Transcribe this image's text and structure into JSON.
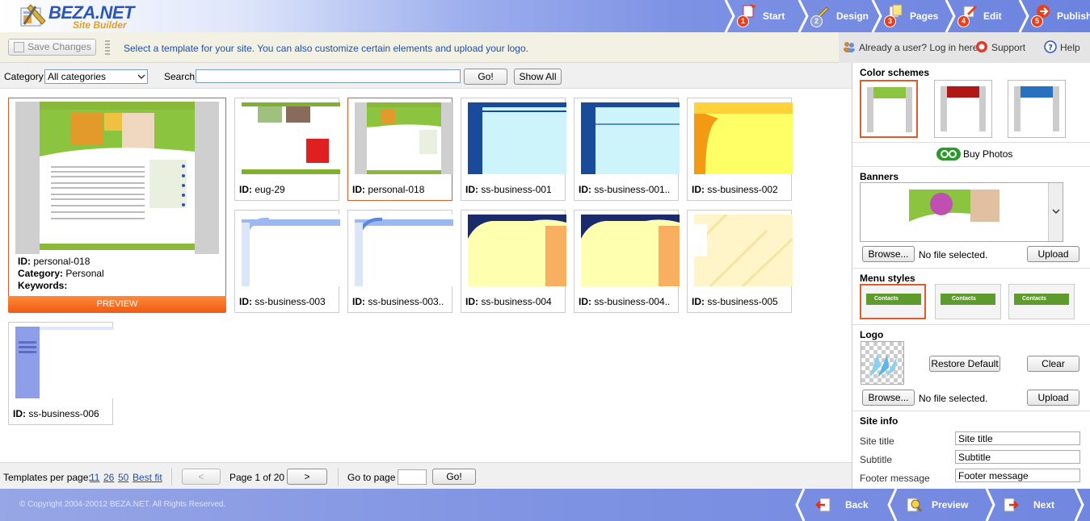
{
  "app": {
    "name": "BEZA.NET",
    "subtitle": "Site Builder"
  },
  "steps": [
    {
      "num": "1",
      "label": "Start"
    },
    {
      "num": "2",
      "label": "Design"
    },
    {
      "num": "3",
      "label": "Pages"
    },
    {
      "num": "4",
      "label": "Edit"
    },
    {
      "num": "5",
      "label": "Publish"
    }
  ],
  "toolbar": {
    "save_label": "Save Changes",
    "message": "Select a template for your site. You can also customize certain elements and upload your logo.",
    "login": "Already a user? Log in here...",
    "support": "Support",
    "help": "Help"
  },
  "filter": {
    "category_label": "Category",
    "category_value": "All categories",
    "search_label": "Search",
    "search_value": "",
    "go_label": "Go!",
    "show_all_label": "Show All"
  },
  "selected": {
    "id_label": "ID:",
    "id": "personal-018",
    "category_label": "Category:",
    "category": "Personal",
    "keywords_label": "Keywords:",
    "preview_label": "PREVIEW"
  },
  "templates": [
    {
      "id": "eug-29"
    },
    {
      "id": "personal-018"
    },
    {
      "id": "ss-business-001"
    },
    {
      "id": "ss-business-001.."
    },
    {
      "id": "ss-business-002"
    },
    {
      "id": "ss-business-003"
    },
    {
      "id": "ss-business-003.."
    },
    {
      "id": "ss-business-004"
    },
    {
      "id": "ss-business-004.."
    },
    {
      "id": "ss-business-005"
    },
    {
      "id": "ss-business-006"
    }
  ],
  "pager": {
    "per_page_label": "Templates per page:",
    "options": [
      "11",
      "26",
      "50",
      "Best fit"
    ],
    "prev": "<",
    "page_text": "Page 1 of 20",
    "next": ">",
    "goto_label": "Go to page",
    "goto_value": "",
    "go_label": "Go!"
  },
  "side": {
    "color_schemes": "Color schemes",
    "buy_photos": "Buy Photos",
    "banners": "Banners",
    "browse": "Browse...",
    "no_file": "No file selected.",
    "upload": "Upload",
    "menu_styles": "Menu styles",
    "menu_sample": "Contacts",
    "logo": "Logo",
    "restore": "Restore Default",
    "clear": "Clear",
    "site_info": "Site info",
    "site_title_label": "Site title",
    "site_title_value": "Site title",
    "subtitle_label": "Subtitle",
    "subtitle_value": "Subtitle",
    "footer_label": "Footer message",
    "footer_value": "Footer message"
  },
  "footer": {
    "copyright": "© Copyright 2004-20012 BEZA.NET. All Rights Reserved.",
    "back": "Back",
    "preview": "Preview",
    "next": "Next"
  },
  "colors": {
    "accent": "#e05a2a",
    "brand": "#2c56b8",
    "link": "#1f4fa8",
    "green": "#5f9a2e"
  }
}
